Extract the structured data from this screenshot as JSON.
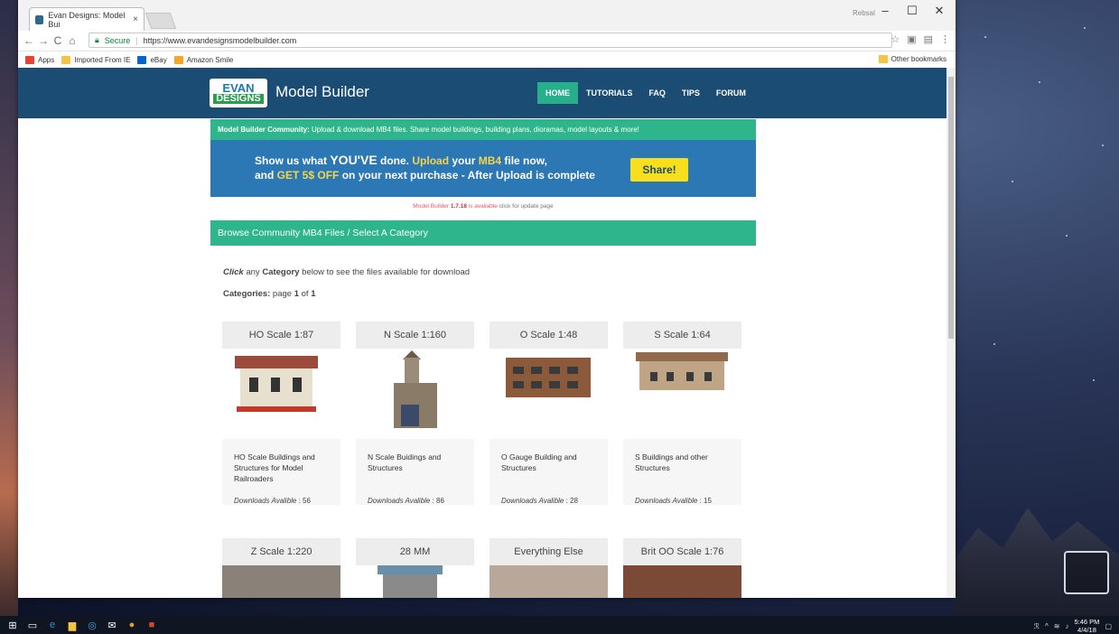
{
  "browser": {
    "tab_title": "Evan Designs: Model Bui",
    "tab_close": "×",
    "user_label": "Rebsal",
    "window_controls": {
      "minimize": "–",
      "maximize": "☐",
      "close": "✕"
    },
    "nav_icons": {
      "back": "←",
      "forward": "→",
      "reload": "C",
      "home": "⌂"
    },
    "secure_label": "Secure",
    "url": "https://www.evandesignsmodelbuilder.com",
    "bookmarks": [
      {
        "label": "Apps",
        "icon": "apps-icon",
        "color": "#e94235"
      },
      {
        "label": "Imported From IE",
        "icon": "folder-icon",
        "color": "#f4c542"
      },
      {
        "label": "eBay",
        "icon": "ebay-icon",
        "color": "#0064d2"
      },
      {
        "label": "Amazon Smile",
        "icon": "amazon-icon",
        "color": "#f6a623"
      }
    ],
    "other_bookmarks": "Other bookmarks"
  },
  "site": {
    "logo_line1": "EVAN",
    "logo_line2": "DESIGNS",
    "brand": "Model Builder",
    "nav": [
      {
        "label": "HOME",
        "active": true
      },
      {
        "label": "TUTORIALS",
        "active": false
      },
      {
        "label": "FAQ",
        "active": false
      },
      {
        "label": "TIPS",
        "active": false
      },
      {
        "label": "FORUM",
        "active": false
      }
    ],
    "community_bold": "Model Builder Community:",
    "community_text": " Upload & download MB4 files. Share model buildings, building plans, dioramas, model layouts & more!",
    "promo": {
      "l1_a": "Show us what ",
      "l1_b": "YOU'VE",
      "l1_c": " done. ",
      "l1_d": "Upload",
      "l1_e": " your ",
      "l1_f": "MB4",
      "l1_g": " file now,",
      "l2_a": "and ",
      "l2_b": "GET 5$ OFF",
      "l2_c": " on your next purchase - After Upload is complete",
      "button": "Share!"
    },
    "update_a": "Model Builder ",
    "update_version": "1.7.18",
    "update_b": " is available",
    "update_c": " click for update page",
    "browse_title": "Browse Community MB4 Files / Select A Category",
    "intro_click": "Click",
    "intro_a": " any ",
    "intro_category": "Category",
    "intro_b": " below to see the files available for download",
    "pages_label": "Categories:",
    "pages_a": " page ",
    "pages_current": "1",
    "pages_b": " of ",
    "pages_total": "1",
    "downloads_label": "Downloads Avalible",
    "downloads_sep": " : ",
    "categories": [
      {
        "title": "HO Scale 1:87",
        "desc": "HO Scale Buildings and Structures for Model Railroaders",
        "downloads": "56"
      },
      {
        "title": "N Scale 1:160",
        "desc": "N Scale Buidings and Structures",
        "downloads": "86"
      },
      {
        "title": "O Scale 1:48",
        "desc": "O Gauge Building and Structures",
        "downloads": "28"
      },
      {
        "title": "S Scale 1:64",
        "desc": "S Buildings and other Structures",
        "downloads": "15"
      },
      {
        "title": "Z Scale 1:220"
      },
      {
        "title": "28 MM"
      },
      {
        "title": "Everything Else"
      },
      {
        "title": "Brit OO Scale 1:76"
      }
    ]
  },
  "taskbar": {
    "clock_time": "5:46 PM",
    "clock_date": "4/4/18"
  }
}
